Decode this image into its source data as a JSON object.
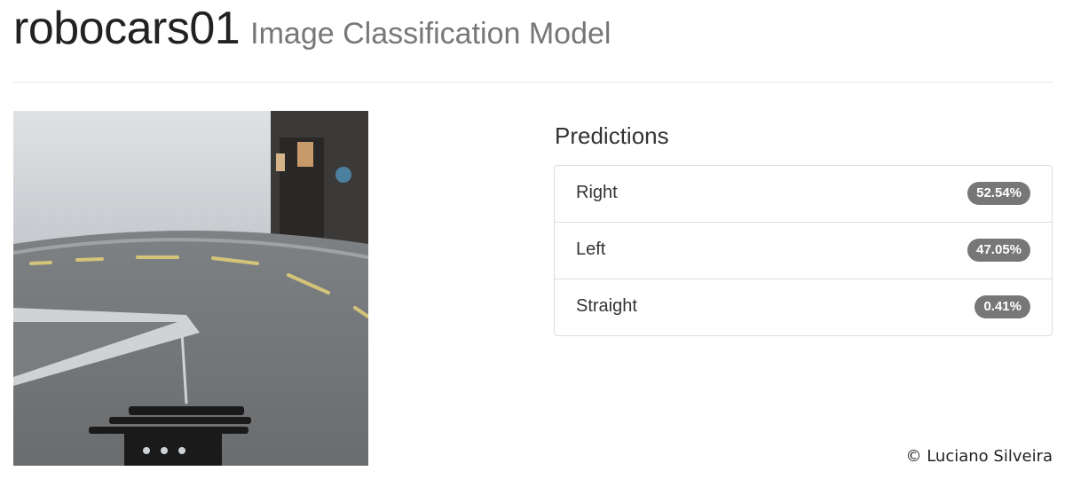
{
  "header": {
    "app_name": "robocars01",
    "subtitle": "Image Classification Model"
  },
  "camera": {
    "icon": "camera-feed-image"
  },
  "predictions": {
    "title": "Predictions",
    "badge_color": "#777777",
    "items": [
      {
        "label": "Right",
        "value": "52.54%",
        "probability": 0.5254
      },
      {
        "label": "Left",
        "value": "47.05%",
        "probability": 0.4705
      },
      {
        "label": "Straight",
        "value": "0.41%",
        "probability": 0.0041
      }
    ]
  },
  "footer": {
    "copyright": "© Luciano Silveira"
  }
}
